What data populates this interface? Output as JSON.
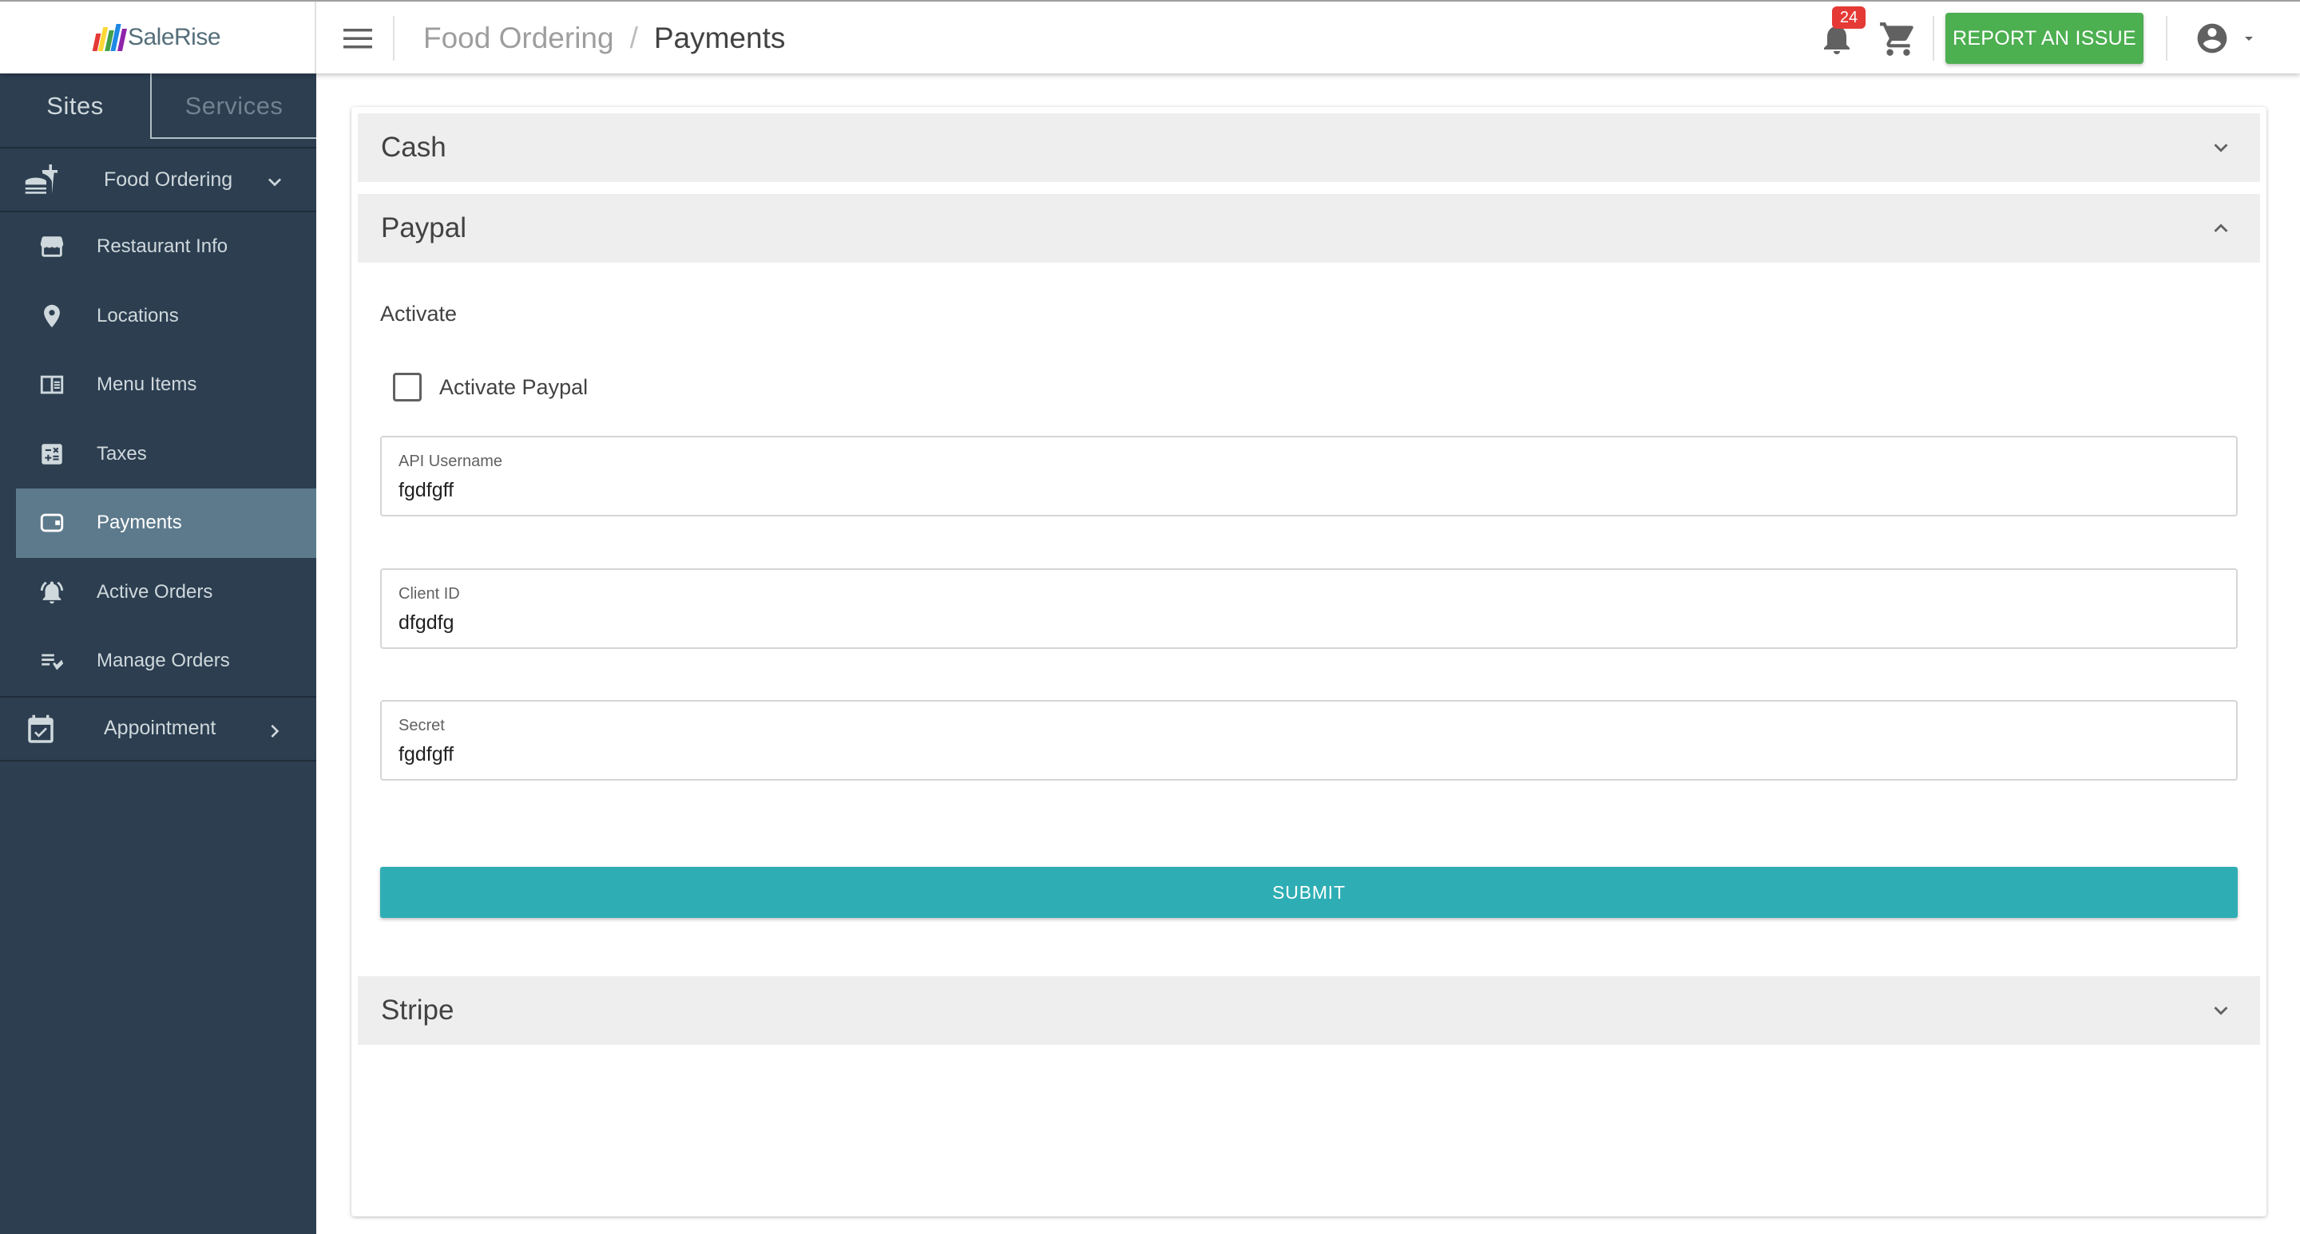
{
  "app": {
    "logo_text": "SaleRise",
    "logo_colors": [
      "#e53935",
      "#fdd835",
      "#43a047",
      "#1e88e5",
      "#8e24aa"
    ]
  },
  "header": {
    "breadcrumb": [
      "Food Ordering",
      "Payments"
    ],
    "breadcrumb_separator": "/",
    "notification_count": "24",
    "report_button_label": "REPORT AN ISSUE",
    "report_button_color": "#4caf50"
  },
  "sidebar": {
    "tabs": [
      {
        "label": "Sites",
        "active": true
      },
      {
        "label": "Services",
        "active": false
      }
    ],
    "groups": [
      {
        "label": "Food Ordering",
        "icon": "food-icon",
        "expanded": true
      },
      {
        "label": "Appointment",
        "icon": "calendar-check-icon",
        "expanded": false
      }
    ],
    "items": [
      {
        "label": "Restaurant Info",
        "icon": "storefront-icon",
        "active": false
      },
      {
        "label": "Locations",
        "icon": "location-pin-icon",
        "active": false
      },
      {
        "label": "Menu Items",
        "icon": "menu-book-icon",
        "active": false
      },
      {
        "label": "Taxes",
        "icon": "calculator-icon",
        "active": false
      },
      {
        "label": "Payments",
        "icon": "wallet-icon",
        "active": true
      },
      {
        "label": "Active Orders",
        "icon": "bell-ring-icon",
        "active": false
      },
      {
        "label": "Manage Orders",
        "icon": "edit-list-icon",
        "active": false
      }
    ],
    "background": "#2c3e50",
    "active_background": "#5d7a8c"
  },
  "panels": [
    {
      "title": "Cash",
      "expanded": false
    },
    {
      "title": "Paypal",
      "expanded": true
    },
    {
      "title": "Stripe",
      "expanded": false
    }
  ],
  "paypal": {
    "section_label": "Activate",
    "checkbox_label": "Activate Paypal",
    "checkbox_checked": false,
    "fields": [
      {
        "label": "API Username",
        "value": "fgdfgff"
      },
      {
        "label": "Client ID",
        "value": "dfgdfg"
      },
      {
        "label": "Secret",
        "value": "fgdfgff"
      }
    ],
    "submit_label": "SUBMIT",
    "submit_color": "#2eaeb4"
  }
}
